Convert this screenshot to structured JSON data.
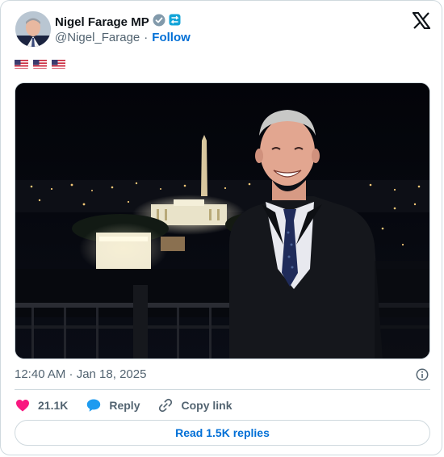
{
  "author": {
    "name": "Nigel Farage MP",
    "handle": "@Nigel_Farage",
    "separator": "·",
    "follow_label": "Follow"
  },
  "tweet": {
    "flags": [
      "us-flag",
      "us-flag",
      "us-flag"
    ],
    "timestamp": "12:40 AM · Jan 18, 2025"
  },
  "actions": {
    "likes_count": "21.1K",
    "reply_label": "Reply",
    "copy_link_label": "Copy link"
  },
  "read_replies_label": "Read 1.5K replies",
  "colors": {
    "link_blue": "#006fd6",
    "like_red": "#f91880",
    "reply_blue": "#1d9bf0",
    "verified_gray": "#829aab",
    "secondary_text": "#536471",
    "border": "#cfd9de"
  },
  "icons": {
    "verified": "verified-badge-icon",
    "affiliate": "affiliate-badge-icon",
    "platform": "x-logo-icon",
    "info": "info-icon",
    "like": "heart-icon",
    "reply": "speech-bubble-icon",
    "copy_link": "link-icon"
  }
}
